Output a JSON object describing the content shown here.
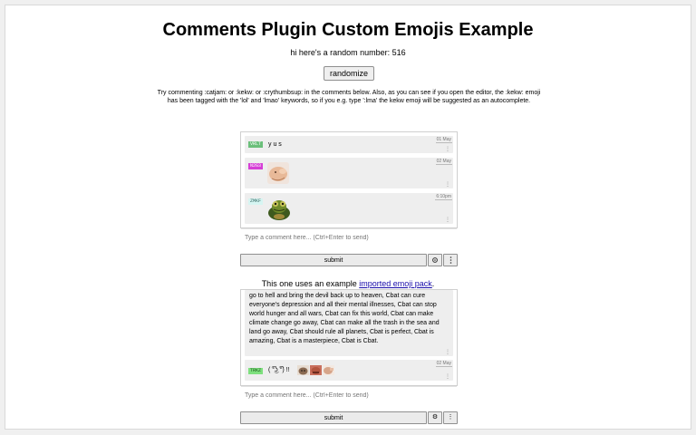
{
  "title": "Comments Plugin Custom Emojis Example",
  "random_line": "hi here's a random number: 516",
  "randomize_label": "randomize",
  "instructions": "Try commenting :catjam: or :kekw: or :crythumbsup: in the comments below. Also, as you can see if you open the editor, the :kekw: emoji has been tagged with the 'lol' and 'lmao' keywords, so if you e.g. type ':lma' the kekw emoji will be suggested as an autocomplete.",
  "box1": {
    "comments": [
      {
        "tag": "VRLT",
        "tag_color": "#6bbf7a",
        "text": "y u s",
        "time": "01 May",
        "dots": "⋮",
        "emoji": ""
      },
      {
        "tag": "N2G3",
        "tag_color": "#d63fd6",
        "text": "",
        "time": "02 May",
        "dots": "⋮",
        "emoji": "face-emoji"
      },
      {
        "tag": "ZMKF",
        "tag_color": "#d6f5f2",
        "text": "",
        "time": "6:10pm",
        "dots": "⋮",
        "emoji": "frog-emoji"
      }
    ],
    "input_placeholder": "Type a comment here... (Ctrl+Enter to send)",
    "submit_label": "submit",
    "gear_icon": "gear-icon",
    "more_icon": "more-icon"
  },
  "pack_line_prefix": "This one uses an example ",
  "pack_link": "imported emoji pack",
  "pack_line_suffix": ".",
  "box2": {
    "long_text": "go to hell and bring the devil back up to heaven, Cbat can cure everyone's depression and all their mental illnesses, Cbat can stop world hunger and all wars, Cbat can fix this world, Cbat can make climate change go away, Cbat can make all the trash in the sea and land go away, Cbat should rule all planets, Cbat is perfect, Cbat is amazing, Cbat is a masterpiece, Cbat is Cbat.",
    "dots": "⋮",
    "comment": {
      "tag": "TRKZ",
      "tag_color": "#7ee07e",
      "text": "( ͡°͜ʖ ͡°) !!",
      "time": "02 May",
      "dots": "⋮"
    },
    "input_placeholder": "Type a comment here... (Ctrl+Enter to send)",
    "submit_label": "submit",
    "gear_glyph": "⚙",
    "more_glyph": "⋮"
  }
}
